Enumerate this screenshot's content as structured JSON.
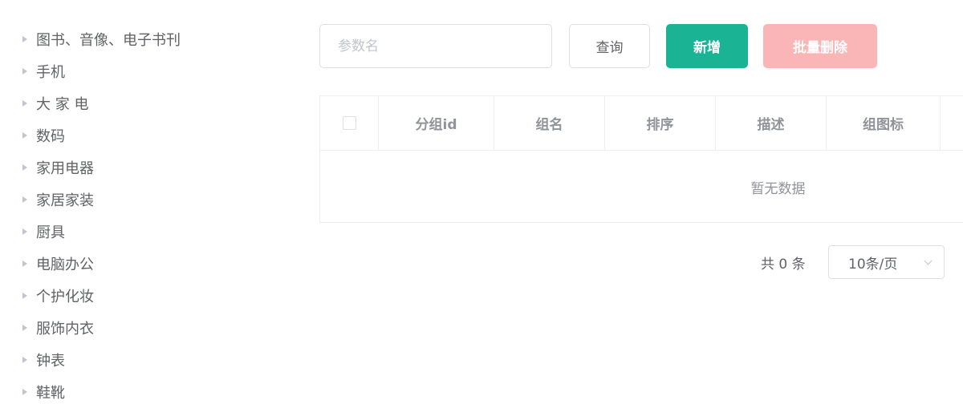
{
  "category_tree": {
    "items": [
      {
        "label": "图书、音像、电子书刊"
      },
      {
        "label": "手机"
      },
      {
        "label": "大 家 电"
      },
      {
        "label": "数码"
      },
      {
        "label": "家用电器"
      },
      {
        "label": "家居家装"
      },
      {
        "label": "厨具"
      },
      {
        "label": "电脑办公"
      },
      {
        "label": "个护化妆"
      },
      {
        "label": "服饰内衣"
      },
      {
        "label": "钟表"
      },
      {
        "label": "鞋靴"
      }
    ]
  },
  "toolbar": {
    "search_value": "",
    "search_placeholder": "参数名",
    "query_label": "查询",
    "add_label": "新增",
    "batch_delete_label": "批量删除"
  },
  "table": {
    "columns": [
      "分组id",
      "组名",
      "排序",
      "描述",
      "组图标"
    ],
    "empty_text": "暂无数据"
  },
  "pagination": {
    "total_text": "共 0 条",
    "page_size_text": "10条/页"
  },
  "colors": {
    "primary": "#1ab394",
    "danger_disabled": "#fab6b6",
    "border": "#dcdfe6",
    "text": "#606266",
    "header_text": "#909399"
  }
}
